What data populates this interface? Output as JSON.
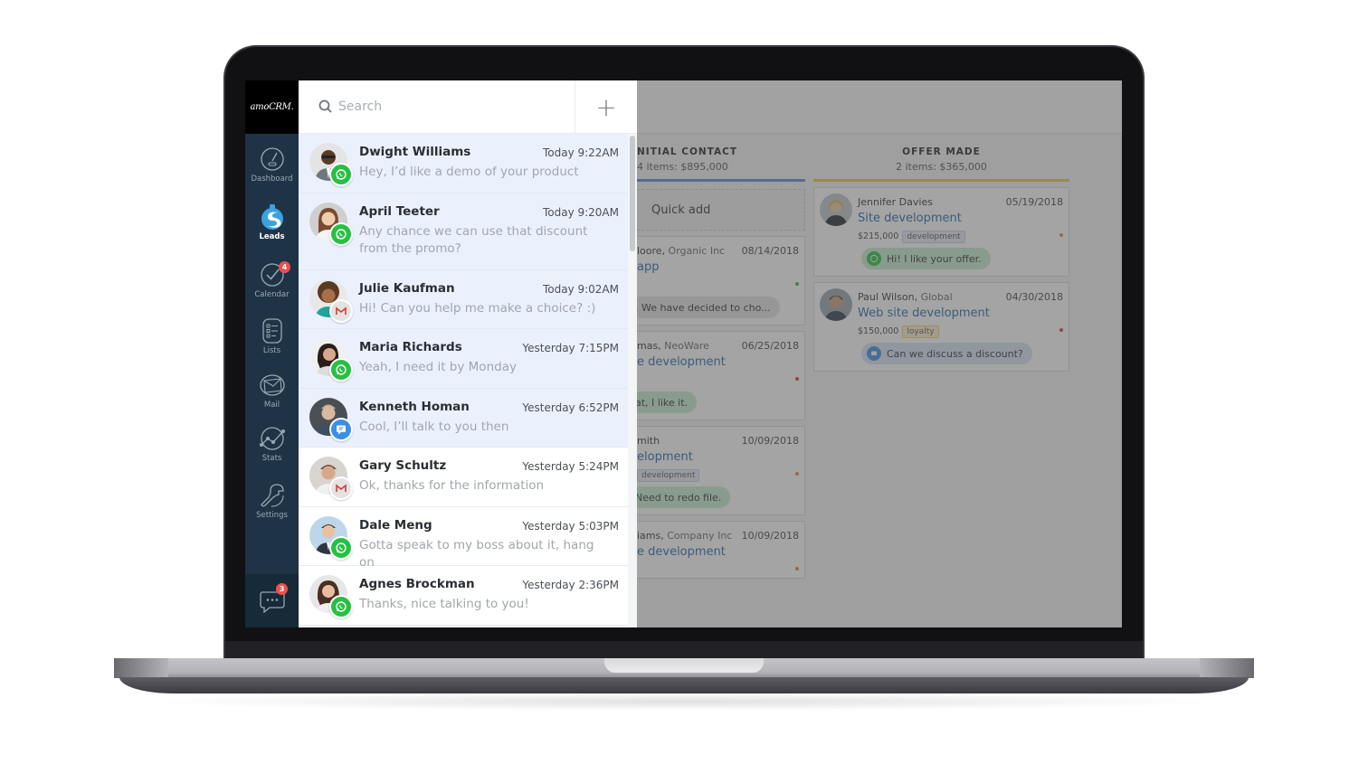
{
  "app": {
    "logo_text": "amoCRM."
  },
  "sidebar": {
    "items": [
      {
        "label": "Dashboard",
        "icon": "speedometer-icon"
      },
      {
        "label": "Leads",
        "icon": "leads-drop-icon",
        "active": true
      },
      {
        "label": "Calendar",
        "icon": "check-circle-icon",
        "badge": "4"
      },
      {
        "label": "Lists",
        "icon": "list-icon"
      },
      {
        "label": "Mail",
        "icon": "mail-icon"
      },
      {
        "label": "Stats",
        "icon": "stats-icon"
      },
      {
        "label": "Settings",
        "icon": "wrench-icon"
      }
    ],
    "chat_badge": "3"
  },
  "chat_panel": {
    "search_placeholder": "Search",
    "add_label": "+",
    "chats": [
      {
        "name": "Dwight Williams",
        "time": "Today 9:22AM",
        "message": "Hey, I’d like a demo of your product",
        "channel": "whatsapp",
        "unread": true
      },
      {
        "name": "April Teeter",
        "time": "Today 9:20AM",
        "message": "Any chance we can use that discount from the promo?",
        "channel": "whatsapp",
        "unread": true
      },
      {
        "name": "Julie Kaufman",
        "time": "Today 9:02AM",
        "message": "Hi! Can you help me make a choice?  :)",
        "channel": "gmail",
        "unread": true
      },
      {
        "name": "Maria Richards",
        "time": "Yesterday 7:15PM",
        "message": "Yeah, I need it by Monday",
        "channel": "whatsapp",
        "unread": true
      },
      {
        "name": "Kenneth Homan",
        "time": "Yesterday 6:52PM",
        "message": "Cool, I’ll talk to you then",
        "channel": "chat",
        "unread": true
      },
      {
        "name": "Gary Schultz",
        "time": "Yesterday 5:24PM",
        "message": "Ok, thanks for the information",
        "channel": "gmail",
        "unread": false
      },
      {
        "name": "Dale Meng",
        "time": "Yesterday 5:03PM",
        "message": "Gotta speak to my boss about it, hang on",
        "channel": "whatsapp",
        "unread": false
      },
      {
        "name": "Agnes Brockman",
        "time": "Yesterday 2:36PM",
        "message": "Thanks, nice talking to you!",
        "channel": "whatsapp",
        "unread": false
      }
    ]
  },
  "pipeline": {
    "columns": [
      {
        "title": "NITIAL CONTACT",
        "subtitle": "4 items: $895,000",
        "accent": "#5b8fc9",
        "quick_add": "Quick add",
        "cards": [
          {
            "who": "loore,",
            "company": " Organic Inc",
            "date": "08/14/2018",
            "title": "app",
            "dot": "#2db85a",
            "bubble": ". We have decided to cho..."
          },
          {
            "who": "mas,",
            "company": " NeoWare",
            "date": "06/25/2018",
            "title": "e development",
            "dot": "#e0364a",
            "bubble": "at, I like it."
          },
          {
            "who": "mith",
            "company": "",
            "date": "10/09/2018",
            "title": "elopment",
            "tag": "development",
            "dot": "#e08a2a",
            "bubble": "Need to redo file."
          },
          {
            "who": "iams,",
            "company": " Company Inc",
            "date": "10/09/2018",
            "title": "e development",
            "dot": "#e08a2a"
          }
        ]
      },
      {
        "title": "OFFER MADE",
        "subtitle": "2 items: $365,000",
        "accent": "#e8cf1d",
        "cards": [
          {
            "who": "Jennifer Davies",
            "company": "",
            "date": "05/19/2018",
            "title": "Site development",
            "price": "$215,000",
            "tag": "development",
            "dot": "#e08a2a",
            "bubble": "Hi! I like your offer.",
            "bubble_channel": "whatsapp"
          },
          {
            "who": "Paul Wilson,",
            "company": " Global",
            "date": "04/30/2018",
            "title": "Web site development",
            "price": "$150,000",
            "tag": "loyalty",
            "dot": "#e0364a",
            "bubble": "Can we discuss a discount?",
            "bubble_channel": "chat"
          }
        ]
      }
    ]
  },
  "colors": {
    "sidebar_bg": "#1e3446",
    "unread_bg": "#eaf1fd",
    "whatsapp": "#26c042",
    "chat": "#3d8fe6",
    "link": "#2466b0"
  }
}
